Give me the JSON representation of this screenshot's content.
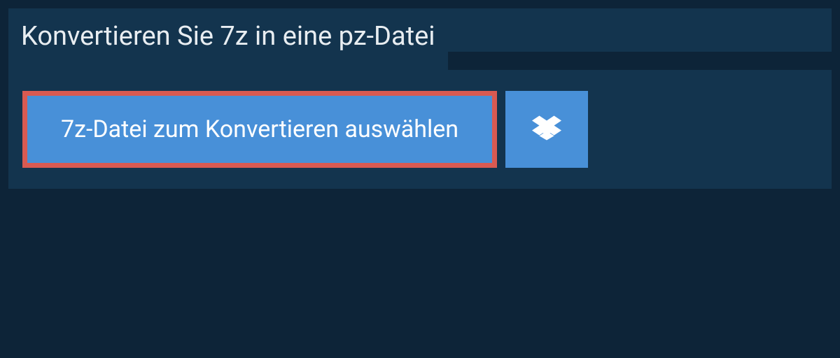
{
  "header": {
    "title": "Konvertieren Sie 7z in eine pz-Datei"
  },
  "actions": {
    "select_file_label": "7z-Datei zum Konvertieren auswählen"
  },
  "colors": {
    "background": "#0d2438",
    "panel": "#13344e",
    "button": "#4890d8",
    "highlight_border": "#d95a52",
    "text_light": "#e8edf1",
    "text_white": "#ffffff"
  }
}
